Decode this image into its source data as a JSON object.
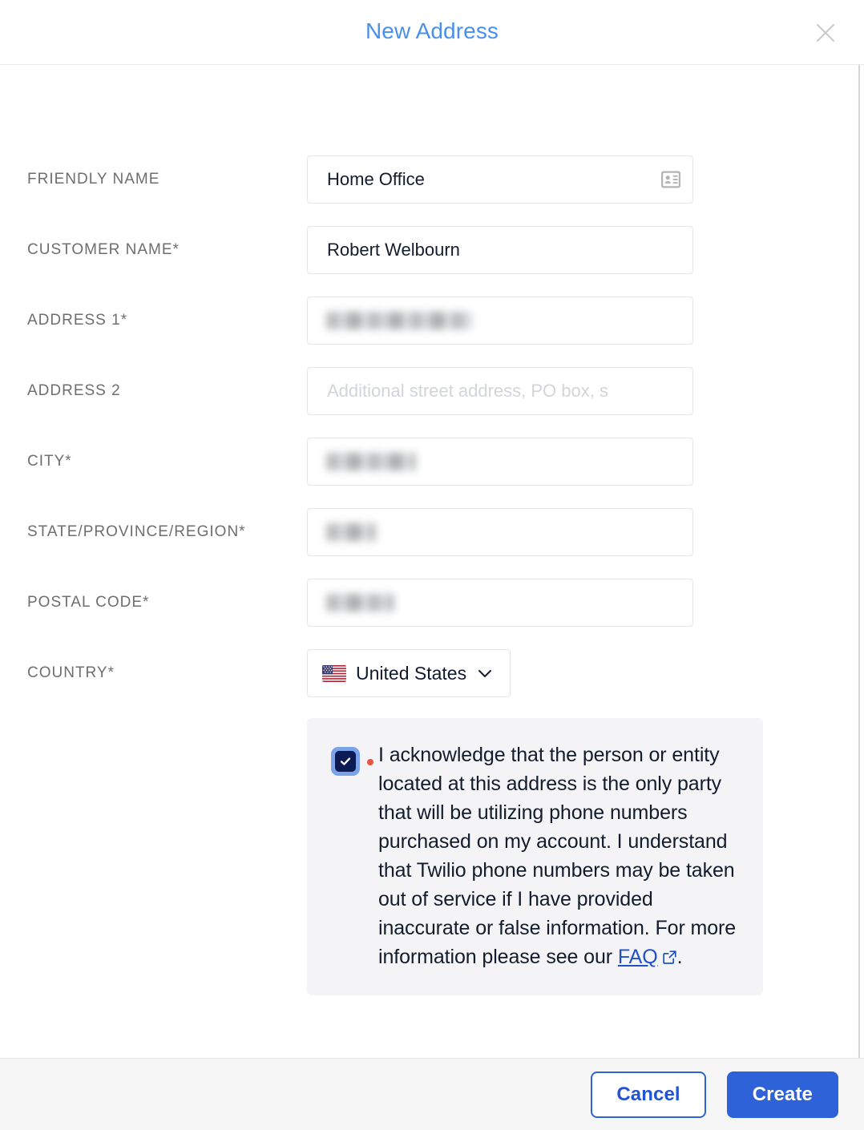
{
  "header": {
    "title": "New Address",
    "close_label": "Close",
    "title_color": "#4a90e8"
  },
  "form": {
    "fields": [
      {
        "label": "FRIENDLY NAME",
        "value": "Home Office",
        "placeholder": "",
        "required": false,
        "icon": "contact-card-icon",
        "redacted": false
      },
      {
        "label": "CUSTOMER NAME*",
        "value": "Robert Welbourn",
        "placeholder": "",
        "required": true,
        "icon": "",
        "redacted": false
      },
      {
        "label": "ADDRESS 1*",
        "value": "",
        "placeholder": "",
        "required": true,
        "icon": "",
        "redacted": true,
        "redacted_width": 182
      },
      {
        "label": "ADDRESS 2",
        "value": "",
        "placeholder": "Additional street address, PO box, s",
        "required": false,
        "icon": "",
        "redacted": false
      },
      {
        "label": "CITY*",
        "value": "",
        "placeholder": "",
        "required": true,
        "icon": "",
        "redacted": true,
        "redacted_width": 112
      },
      {
        "label": "STATE/PROVINCE/REGION*",
        "value": "",
        "placeholder": "",
        "required": true,
        "icon": "",
        "redacted": true,
        "redacted_width": 62
      },
      {
        "label": "POSTAL CODE*",
        "value": "",
        "placeholder": "",
        "required": true,
        "icon": "",
        "redacted": true,
        "redacted_width": 84
      }
    ],
    "country": {
      "label": "COUNTRY*",
      "selected": "United States",
      "flag": "us-flag-icon",
      "chevron": "chevron-down-icon"
    }
  },
  "acknowledgement": {
    "checked": true,
    "required": true,
    "text_before_link": "I acknowledge that the person or entity located at this address is the only party that will be utilizing phone numbers purchased on my account. I understand that Twilio phone numbers may be taken out of service if I have provided inaccurate or false information. For more information please see our ",
    "link_label": "FAQ",
    "link_icon": "external-link-icon",
    "text_after_link": ".",
    "panel_color": "#f4f4f6",
    "checkbox_color": "#0d1b55",
    "checkbox_ring_color": "#7ba3ea",
    "required_dot_color": "#e8543f",
    "link_color": "#1f51c9"
  },
  "footer": {
    "cancel_label": "Cancel",
    "create_label": "Create",
    "primary_color": "#2d62d8"
  }
}
